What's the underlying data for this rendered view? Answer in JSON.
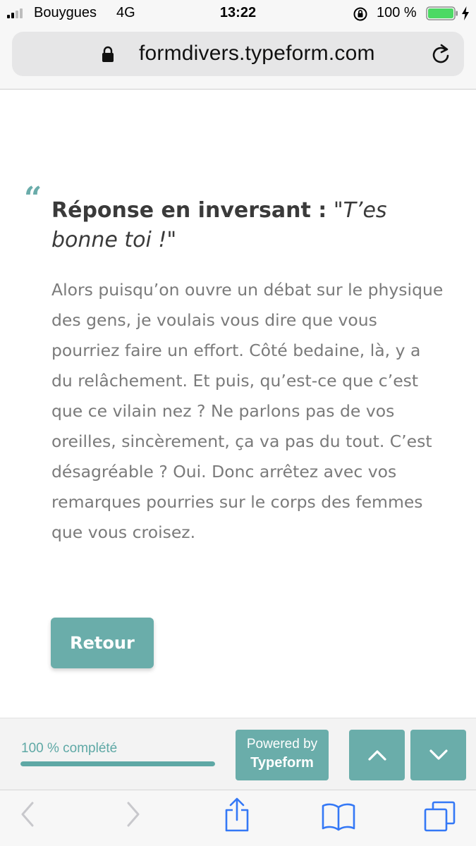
{
  "status_bar": {
    "carrier": "Bouygues",
    "network": "4G",
    "time": "13:22",
    "battery_percent": "100 %",
    "battery_level": 1.0,
    "icons": [
      "signal-icon",
      "orientation-lock-icon",
      "battery-icon",
      "charging-icon"
    ]
  },
  "browser": {
    "url": "formdivers.typeform.com",
    "icons": [
      "lock-icon",
      "reload-icon"
    ]
  },
  "content": {
    "quote_mark": "“",
    "question_bold": "Réponse en inversant :",
    "question_italic": "\"T’es bonne toi !\"",
    "answer": "Alors puisqu’on ouvre un débat sur le physique des gens, je voulais vous dire que vous pourriez faire un effort. Côté bedaine, là, y a du relâchement. Et puis, qu’est-ce que c’est que ce vilain nez ? Ne parlons pas de vos oreilles, sincèrement, ça va pas du tout. C’est désagréable ? Oui. Donc arrêtez avec vos remarques pourries sur le corps des femmes que vous croisez.",
    "back_button": "Retour"
  },
  "footer": {
    "progress_label": "100 % complété",
    "progress_value": 1.0,
    "powered_by": "Powered by",
    "brand": "Typeform",
    "icons": [
      "chevron-up-icon",
      "chevron-down-icon"
    ]
  },
  "toolbar": {
    "icons": [
      "back-icon",
      "forward-icon",
      "share-icon",
      "bookmarks-icon",
      "tabs-icon"
    ]
  },
  "colors": {
    "accent": "#6aadaa",
    "ios_blue": "#3478f6",
    "text_title": "#3a3a3a",
    "text_body": "#7a7a7a"
  }
}
